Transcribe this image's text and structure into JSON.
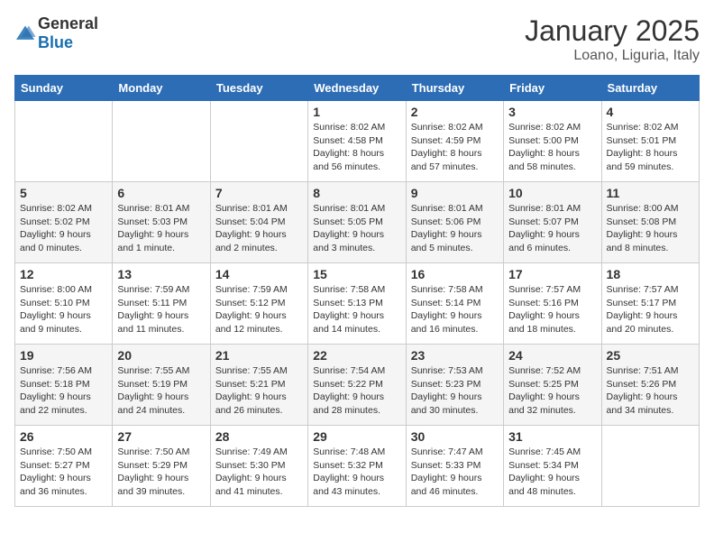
{
  "header": {
    "logo_general": "General",
    "logo_blue": "Blue",
    "title": "January 2025",
    "subtitle": "Loano, Liguria, Italy"
  },
  "days": [
    "Sunday",
    "Monday",
    "Tuesday",
    "Wednesday",
    "Thursday",
    "Friday",
    "Saturday"
  ],
  "weeks": [
    [
      {
        "date": "",
        "text": ""
      },
      {
        "date": "",
        "text": ""
      },
      {
        "date": "",
        "text": ""
      },
      {
        "date": "1",
        "text": "Sunrise: 8:02 AM\nSunset: 4:58 PM\nDaylight: 8 hours\nand 56 minutes."
      },
      {
        "date": "2",
        "text": "Sunrise: 8:02 AM\nSunset: 4:59 PM\nDaylight: 8 hours\nand 57 minutes."
      },
      {
        "date": "3",
        "text": "Sunrise: 8:02 AM\nSunset: 5:00 PM\nDaylight: 8 hours\nand 58 minutes."
      },
      {
        "date": "4",
        "text": "Sunrise: 8:02 AM\nSunset: 5:01 PM\nDaylight: 8 hours\nand 59 minutes."
      }
    ],
    [
      {
        "date": "5",
        "text": "Sunrise: 8:02 AM\nSunset: 5:02 PM\nDaylight: 9 hours\nand 0 minutes."
      },
      {
        "date": "6",
        "text": "Sunrise: 8:01 AM\nSunset: 5:03 PM\nDaylight: 9 hours\nand 1 minute."
      },
      {
        "date": "7",
        "text": "Sunrise: 8:01 AM\nSunset: 5:04 PM\nDaylight: 9 hours\nand 2 minutes."
      },
      {
        "date": "8",
        "text": "Sunrise: 8:01 AM\nSunset: 5:05 PM\nDaylight: 9 hours\nand 3 minutes."
      },
      {
        "date": "9",
        "text": "Sunrise: 8:01 AM\nSunset: 5:06 PM\nDaylight: 9 hours\nand 5 minutes."
      },
      {
        "date": "10",
        "text": "Sunrise: 8:01 AM\nSunset: 5:07 PM\nDaylight: 9 hours\nand 6 minutes."
      },
      {
        "date": "11",
        "text": "Sunrise: 8:00 AM\nSunset: 5:08 PM\nDaylight: 9 hours\nand 8 minutes."
      }
    ],
    [
      {
        "date": "12",
        "text": "Sunrise: 8:00 AM\nSunset: 5:10 PM\nDaylight: 9 hours\nand 9 minutes."
      },
      {
        "date": "13",
        "text": "Sunrise: 7:59 AM\nSunset: 5:11 PM\nDaylight: 9 hours\nand 11 minutes."
      },
      {
        "date": "14",
        "text": "Sunrise: 7:59 AM\nSunset: 5:12 PM\nDaylight: 9 hours\nand 12 minutes."
      },
      {
        "date": "15",
        "text": "Sunrise: 7:58 AM\nSunset: 5:13 PM\nDaylight: 9 hours\nand 14 minutes."
      },
      {
        "date": "16",
        "text": "Sunrise: 7:58 AM\nSunset: 5:14 PM\nDaylight: 9 hours\nand 16 minutes."
      },
      {
        "date": "17",
        "text": "Sunrise: 7:57 AM\nSunset: 5:16 PM\nDaylight: 9 hours\nand 18 minutes."
      },
      {
        "date": "18",
        "text": "Sunrise: 7:57 AM\nSunset: 5:17 PM\nDaylight: 9 hours\nand 20 minutes."
      }
    ],
    [
      {
        "date": "19",
        "text": "Sunrise: 7:56 AM\nSunset: 5:18 PM\nDaylight: 9 hours\nand 22 minutes."
      },
      {
        "date": "20",
        "text": "Sunrise: 7:55 AM\nSunset: 5:19 PM\nDaylight: 9 hours\nand 24 minutes."
      },
      {
        "date": "21",
        "text": "Sunrise: 7:55 AM\nSunset: 5:21 PM\nDaylight: 9 hours\nand 26 minutes."
      },
      {
        "date": "22",
        "text": "Sunrise: 7:54 AM\nSunset: 5:22 PM\nDaylight: 9 hours\nand 28 minutes."
      },
      {
        "date": "23",
        "text": "Sunrise: 7:53 AM\nSunset: 5:23 PM\nDaylight: 9 hours\nand 30 minutes."
      },
      {
        "date": "24",
        "text": "Sunrise: 7:52 AM\nSunset: 5:25 PM\nDaylight: 9 hours\nand 32 minutes."
      },
      {
        "date": "25",
        "text": "Sunrise: 7:51 AM\nSunset: 5:26 PM\nDaylight: 9 hours\nand 34 minutes."
      }
    ],
    [
      {
        "date": "26",
        "text": "Sunrise: 7:50 AM\nSunset: 5:27 PM\nDaylight: 9 hours\nand 36 minutes."
      },
      {
        "date": "27",
        "text": "Sunrise: 7:50 AM\nSunset: 5:29 PM\nDaylight: 9 hours\nand 39 minutes."
      },
      {
        "date": "28",
        "text": "Sunrise: 7:49 AM\nSunset: 5:30 PM\nDaylight: 9 hours\nand 41 minutes."
      },
      {
        "date": "29",
        "text": "Sunrise: 7:48 AM\nSunset: 5:32 PM\nDaylight: 9 hours\nand 43 minutes."
      },
      {
        "date": "30",
        "text": "Sunrise: 7:47 AM\nSunset: 5:33 PM\nDaylight: 9 hours\nand 46 minutes."
      },
      {
        "date": "31",
        "text": "Sunrise: 7:45 AM\nSunset: 5:34 PM\nDaylight: 9 hours\nand 48 minutes."
      },
      {
        "date": "",
        "text": ""
      }
    ]
  ]
}
